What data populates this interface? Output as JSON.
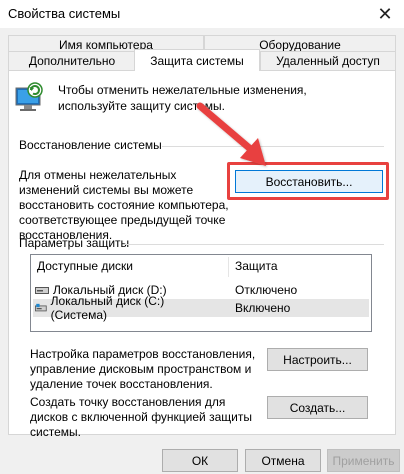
{
  "window": {
    "title": "Свойства системы"
  },
  "tabs": {
    "computer_name": "Имя компьютера",
    "hardware": "Оборудование",
    "advanced": "Дополнительно",
    "system_protection": "Защита системы",
    "remote": "Удаленный доступ"
  },
  "intro_text": "Чтобы отменить нежелательные изменения, используйте защиту системы.",
  "restore_section": {
    "title": "Восстановление системы",
    "description": "Для отмены нежелательных изменений системы вы можете восстановить состояние компьютера, соответствующее предыдущей точке восстановления.",
    "button": "Восстановить..."
  },
  "protection_section": {
    "title": "Параметры защиты",
    "columns": {
      "drives": "Доступные диски",
      "protection": "Защита"
    },
    "rows": [
      {
        "drive": "Локальный диск (D:)",
        "status": "Отключено",
        "icon": "hdd-icon"
      },
      {
        "drive": "Локальный диск (C:) (Система)",
        "status": "Включено",
        "icon": "system-drive-icon"
      }
    ],
    "configure_text": "Настройка параметров восстановления, управление дисковым пространством и удаление точек восстановления.",
    "configure_button": "Настроить...",
    "create_text": "Создать точку восстановления для дисков с включенной функцией защиты системы.",
    "create_button": "Создать..."
  },
  "footer": {
    "ok": "ОК",
    "cancel": "Отмена",
    "apply": "Применить"
  },
  "colors": {
    "highlight": "#e8413f",
    "focus_border": "#0078d7"
  }
}
